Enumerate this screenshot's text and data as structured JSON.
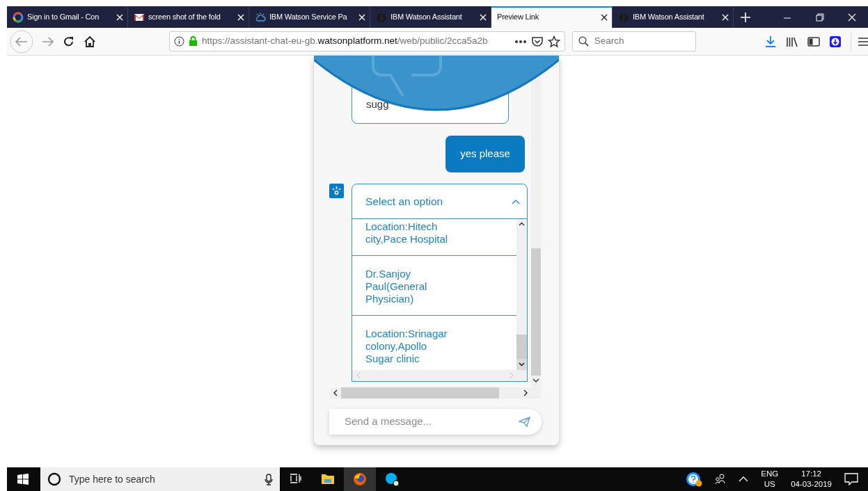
{
  "browser": {
    "tabs": [
      {
        "title": "Sign in to Gmail - Con",
        "selected": false
      },
      {
        "title": "screen shot of the fold",
        "selected": false
      },
      {
        "title": "IBM Watson Service Pa",
        "selected": false
      },
      {
        "title": "IBM Watson Assistant",
        "selected": false
      },
      {
        "title": "Preview Link",
        "selected": true
      },
      {
        "title": "IBM Watson Assistant",
        "selected": false
      }
    ],
    "address": {
      "url_start": "https://assistant-chat-eu-gb.",
      "url_domain": "watsonplatform.net",
      "url_end": "/web/public/2cca5a2b"
    },
    "search": {
      "placeholder": "Search"
    }
  },
  "chat": {
    "messages": [
      {
        "kind": "bot",
        "text": "sugg"
      },
      {
        "kind": "user",
        "text": "yes please"
      }
    ],
    "dropdown": {
      "title": "Select an option",
      "expanded": true,
      "options": [
        "Location:Hitech city,Pace Hospital",
        "Dr.Sanjoy Paul(General Physician)",
        "Location:Srinagar colony,Apollo Sugar clinic"
      ]
    },
    "composer": {
      "placeholder": "Send a message..."
    }
  },
  "taskbar": {
    "search_placeholder": "Type here to search",
    "language": "ENG",
    "region": "US",
    "time": "17:12",
    "date": "04-03-2019"
  }
}
